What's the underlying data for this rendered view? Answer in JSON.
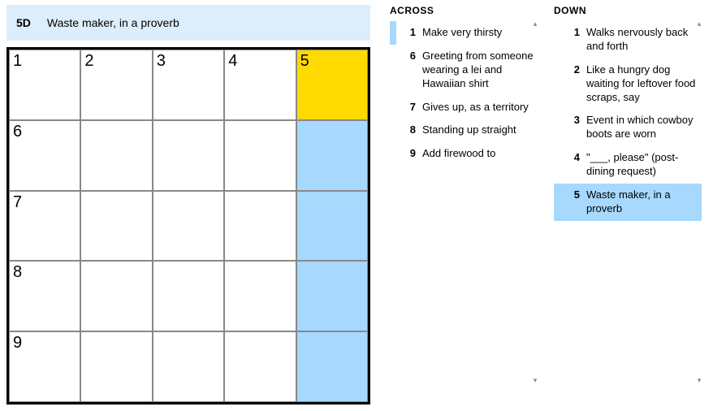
{
  "current_clue": {
    "label": "5D",
    "text": "Waste maker, in a proverb"
  },
  "grid": {
    "rows": 5,
    "cols": 5,
    "cells": [
      {
        "r": 0,
        "c": 0,
        "num": "1"
      },
      {
        "r": 0,
        "c": 1,
        "num": "2"
      },
      {
        "r": 0,
        "c": 2,
        "num": "3"
      },
      {
        "r": 0,
        "c": 3,
        "num": "4"
      },
      {
        "r": 0,
        "c": 4,
        "num": "5",
        "state": "selected"
      },
      {
        "r": 1,
        "c": 0,
        "num": "6"
      },
      {
        "r": 1,
        "c": 1
      },
      {
        "r": 1,
        "c": 2
      },
      {
        "r": 1,
        "c": 3
      },
      {
        "r": 1,
        "c": 4,
        "state": "highlight"
      },
      {
        "r": 2,
        "c": 0,
        "num": "7"
      },
      {
        "r": 2,
        "c": 1
      },
      {
        "r": 2,
        "c": 2
      },
      {
        "r": 2,
        "c": 3
      },
      {
        "r": 2,
        "c": 4,
        "state": "highlight"
      },
      {
        "r": 3,
        "c": 0,
        "num": "8"
      },
      {
        "r": 3,
        "c": 1
      },
      {
        "r": 3,
        "c": 2
      },
      {
        "r": 3,
        "c": 3
      },
      {
        "r": 3,
        "c": 4,
        "state": "highlight"
      },
      {
        "r": 4,
        "c": 0,
        "num": "9"
      },
      {
        "r": 4,
        "c": 1
      },
      {
        "r": 4,
        "c": 2
      },
      {
        "r": 4,
        "c": 3
      },
      {
        "r": 4,
        "c": 4,
        "state": "highlight"
      }
    ]
  },
  "headers": {
    "across": "ACROSS",
    "down": "DOWN"
  },
  "across": [
    {
      "num": "1",
      "text": "Make very thirsty",
      "active": "bar"
    },
    {
      "num": "6",
      "text": "Greeting from someone wearing a lei and Hawaiian shirt"
    },
    {
      "num": "7",
      "text": "Gives up, as a territory"
    },
    {
      "num": "8",
      "text": "Standing up straight"
    },
    {
      "num": "9",
      "text": "Add firewood to"
    }
  ],
  "down": [
    {
      "num": "1",
      "text": "Walks nervously back and forth"
    },
    {
      "num": "2",
      "text": "Like a hungry dog waiting for leftover food scraps, say"
    },
    {
      "num": "3",
      "text": "Event in which cowboy boots are worn"
    },
    {
      "num": "4",
      "text": "\"___, please\" (post-dining request)"
    },
    {
      "num": "5",
      "text": "Waste maker, in a proverb",
      "active": "full"
    }
  ]
}
